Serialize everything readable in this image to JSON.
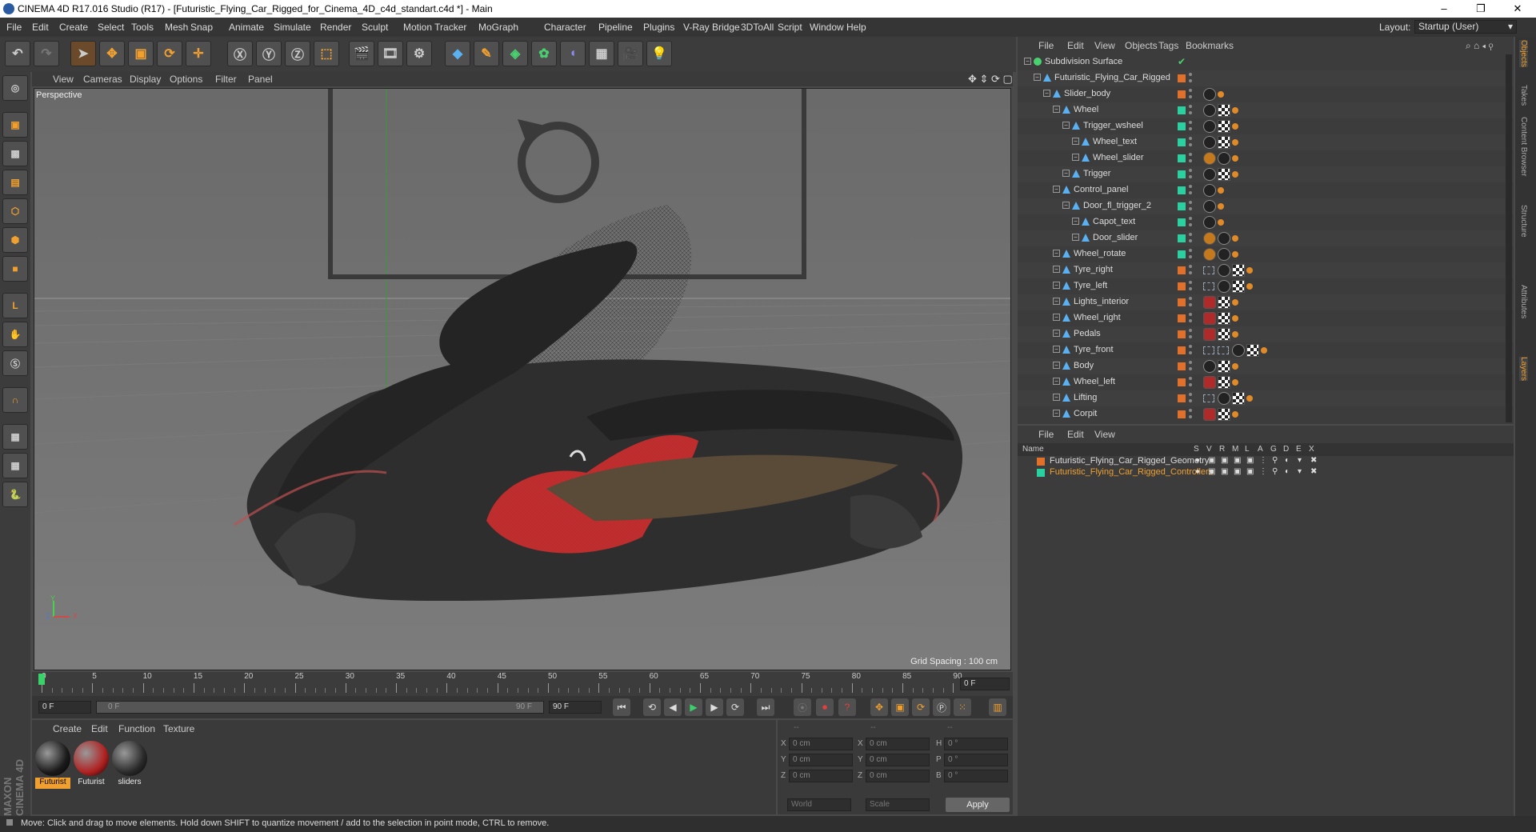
{
  "window": {
    "title": "CINEMA 4D R17.016 Studio (R17) - [Futuristic_Flying_Car_Rigged_for_Cinema_4D_c4d_standart.c4d *] - Main",
    "minimize": "–",
    "maximize": "❐",
    "close": "✕"
  },
  "menu": [
    "File",
    "Edit",
    "Create",
    "Select",
    "Tools",
    "Mesh",
    "Snap",
    "Animate",
    "Simulate",
    "Render",
    "Sculpt",
    "Motion Tracker",
    "MoGraph",
    "Character",
    "Pipeline",
    "Plugins",
    "V-Ray Bridge",
    "3DToAll",
    "Script",
    "Window",
    "Help"
  ],
  "layout": {
    "label": "Layout:",
    "value": "Startup (User)"
  },
  "viewport": {
    "menu": [
      "View",
      "Cameras",
      "Display",
      "Options",
      "Filter",
      "Panel"
    ],
    "label": "Perspective",
    "grid_spacing": "Grid Spacing : 100 cm",
    "axis_y": "Y",
    "axis_x": "X",
    "axis_z": "Z"
  },
  "timeline": {
    "ticks": [
      "0",
      "5",
      "10",
      "15",
      "20",
      "25",
      "30",
      "35",
      "40",
      "45",
      "50",
      "55",
      "60",
      "65",
      "70",
      "75",
      "80",
      "85",
      "90"
    ],
    "current": "0 F"
  },
  "playbar": {
    "start": "0 F",
    "range_start": "0 F",
    "range_end": "90 F",
    "end": "90 F"
  },
  "materials": {
    "menu": [
      "Create",
      "Edit",
      "Function",
      "Texture"
    ],
    "items": [
      {
        "label": "Futurist",
        "color": "#1a1a1a"
      },
      {
        "label": "Futurist",
        "color": "#b02020"
      },
      {
        "label": "sliders",
        "color": "#2a2a2a"
      }
    ]
  },
  "coords": {
    "header": [
      "--",
      "--",
      "--"
    ],
    "rows": [
      {
        "a": "X",
        "av": "0 cm",
        "b": "X",
        "bv": "0 cm",
        "c": "H",
        "cv": "0 °"
      },
      {
        "a": "Y",
        "av": "0 cm",
        "b": "Y",
        "bv": "0 cm",
        "c": "P",
        "cv": "0 °"
      },
      {
        "a": "Z",
        "av": "0 cm",
        "b": "Z",
        "bv": "0 cm",
        "c": "B",
        "cv": "0 °"
      }
    ],
    "world": "World",
    "scale": "Scale",
    "apply": "Apply"
  },
  "status": "Move: Click and drag to move elements. Hold down SHIFT to quantize movement / add to the selection in point mode, CTRL to remove.",
  "branding": "MAXON CINEMA 4D",
  "objects": {
    "menu": [
      "File",
      "Edit",
      "View",
      "Objects",
      "Tags",
      "Bookmarks"
    ],
    "items": [
      {
        "name": "Subdivision Surface",
        "indent": 0,
        "color": "",
        "tags": ""
      },
      {
        "name": "Futuristic_Flying_Car_Rigged",
        "indent": 1,
        "color": "#e0702a",
        "tags": ""
      },
      {
        "name": "Slider_body",
        "indent": 2,
        "color": "#e0702a",
        "tags": "b"
      },
      {
        "name": "Wheel",
        "indent": 3,
        "color": "#2ad0a0",
        "tags": "bc"
      },
      {
        "name": "Trigger_wsheel",
        "indent": 4,
        "color": "#2ad0a0",
        "tags": "bc"
      },
      {
        "name": "Wheel_text",
        "indent": 5,
        "color": "#2ad0a0",
        "tags": "bc"
      },
      {
        "name": "Wheel_slider",
        "indent": 5,
        "color": "#2ad0a0",
        "tags": "nb"
      },
      {
        "name": "Trigger",
        "indent": 4,
        "color": "#2ad0a0",
        "tags": "bc"
      },
      {
        "name": "Control_panel",
        "indent": 3,
        "color": "#2ad0a0",
        "tags": "b"
      },
      {
        "name": "Door_fl_trigger_2",
        "indent": 4,
        "color": "#2ad0a0",
        "tags": "b"
      },
      {
        "name": "Capot_text",
        "indent": 5,
        "color": "#2ad0a0",
        "tags": "b"
      },
      {
        "name": "Door_slider",
        "indent": 5,
        "color": "#2ad0a0",
        "tags": "nb"
      },
      {
        "name": "Wheel_rotate",
        "indent": 3,
        "color": "#2ad0a0",
        "tags": "nb"
      },
      {
        "name": "Tyre_right",
        "indent": 3,
        "color": "#e0702a",
        "tags": "xbc"
      },
      {
        "name": "Tyre_left",
        "indent": 3,
        "color": "#e0702a",
        "tags": "xbc"
      },
      {
        "name": "Lights_interior",
        "indent": 3,
        "color": "#e0702a",
        "tags": "rc"
      },
      {
        "name": "Wheel_right",
        "indent": 3,
        "color": "#e0702a",
        "tags": "rc"
      },
      {
        "name": "Pedals",
        "indent": 3,
        "color": "#e0702a",
        "tags": "rc"
      },
      {
        "name": "Tyre_front",
        "indent": 3,
        "color": "#e0702a",
        "tags": "xxbc"
      },
      {
        "name": "Body",
        "indent": 3,
        "color": "#e0702a",
        "tags": "bc"
      },
      {
        "name": "Wheel_left",
        "indent": 3,
        "color": "#e0702a",
        "tags": "rc"
      },
      {
        "name": "Lifting",
        "indent": 3,
        "color": "#e0702a",
        "tags": "xbc"
      },
      {
        "name": "Corpit",
        "indent": 3,
        "color": "#e0702a",
        "tags": "rc"
      }
    ]
  },
  "layers": {
    "menu": [
      "File",
      "Edit",
      "View"
    ],
    "columns": [
      "Name",
      "S",
      "V",
      "R",
      "M",
      "L",
      "A",
      "G",
      "D",
      "E",
      "X"
    ],
    "items": [
      {
        "name": "Futuristic_Flying_Car_Rigged_Geometry",
        "color": "#e0702a",
        "text": "#dddddd"
      },
      {
        "name": "Futuristic_Flying_Car_Rigged_Controllers",
        "color": "#2ad0a0",
        "text": "#f0a030"
      }
    ]
  },
  "right_tabs": [
    "Objects",
    "Takes",
    "Content Browser",
    "Structure",
    "Attributes",
    "Layers"
  ]
}
